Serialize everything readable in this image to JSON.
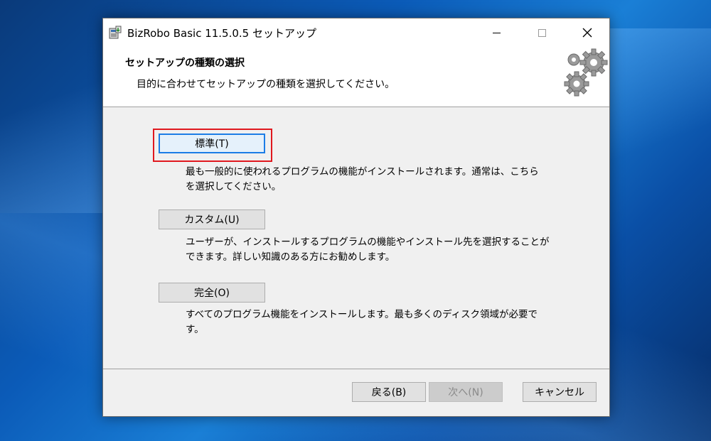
{
  "window": {
    "title": "BizRobo Basic 11.5.0.5 セットアップ",
    "controls": {
      "minimize_icon": "minimize-icon",
      "maximize_icon": "maximize-icon",
      "close_icon": "close-icon"
    }
  },
  "header": {
    "title": "セットアップの種類の選択",
    "subtitle": "目的に合わせてセットアップの種類を選択してください。",
    "icon": "gears-icon"
  },
  "options": [
    {
      "label": "標準(T)",
      "description": [
        "最も一般的に使われるプログラムの機能がインストールされます。通常は、こちら",
        "を選択してください。"
      ]
    },
    {
      "label": "カスタム(U)",
      "description": [
        "ユーザーが、インストールするプログラムの機能やインストール先を選択することが",
        "できます。詳しい知識のある方にお勧めします。"
      ]
    },
    {
      "label": "完全(O)",
      "description": [
        "すべてのプログラム機能をインストールします。最も多くのディスク領域が必要で",
        "す。"
      ]
    }
  ],
  "footer": {
    "back_label": "戻る(B)",
    "next_label": "次へ(N)",
    "cancel_label": "キャンセル"
  },
  "colors": {
    "highlight": "#e0181e",
    "focus": "#1c7de6"
  }
}
